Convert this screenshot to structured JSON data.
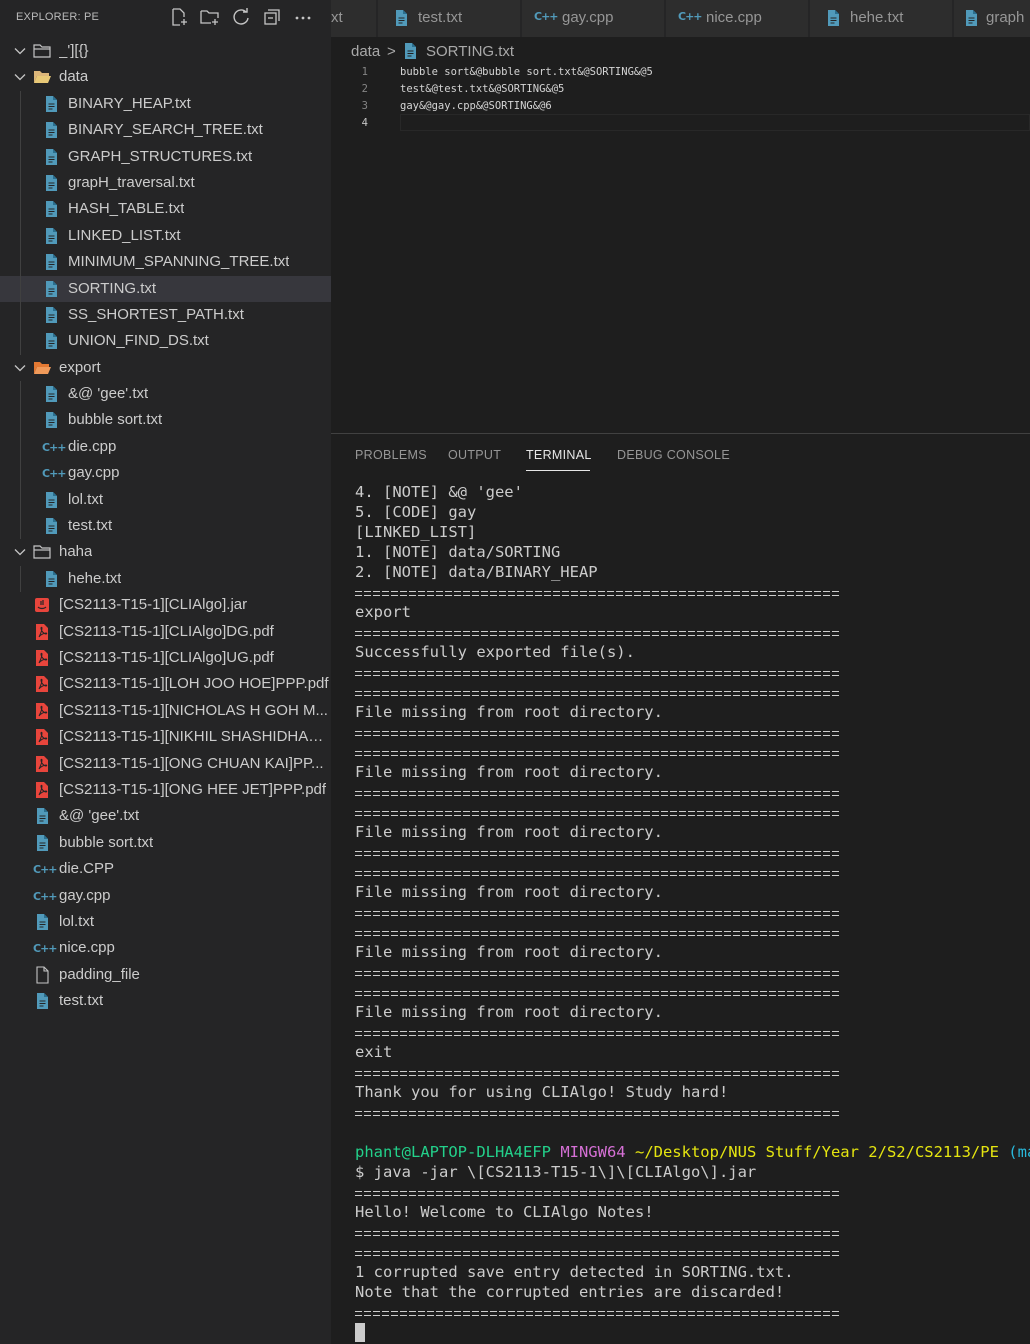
{
  "sidebar": {
    "title": "EXPLORER: PE",
    "tree": [
      {
        "label": "_'][{}",
        "kind": "folder",
        "depth": 0,
        "expanded": true
      },
      {
        "label": "data",
        "kind": "folder-open",
        "depth": 0,
        "expanded": true
      },
      {
        "label": "BINARY_HEAP.txt",
        "kind": "txt",
        "depth": 1
      },
      {
        "label": "BINARY_SEARCH_TREE.txt",
        "kind": "txt",
        "depth": 1
      },
      {
        "label": "GRAPH_STRUCTURES.txt",
        "kind": "txt",
        "depth": 1
      },
      {
        "label": "grapH_traversal.txt",
        "kind": "txt",
        "depth": 1
      },
      {
        "label": "HASH_TABLE.txt",
        "kind": "txt",
        "depth": 1
      },
      {
        "label": "LINKED_LIST.txt",
        "kind": "txt",
        "depth": 1
      },
      {
        "label": "MINIMUM_SPANNING_TREE.txt",
        "kind": "txt",
        "depth": 1
      },
      {
        "label": "SORTING.txt",
        "kind": "txt",
        "depth": 1,
        "selected": true
      },
      {
        "label": "SS_SHORTEST_PATH.txt",
        "kind": "txt",
        "depth": 1
      },
      {
        "label": "UNION_FIND_DS.txt",
        "kind": "txt",
        "depth": 1
      },
      {
        "label": "export",
        "kind": "folder-export",
        "depth": 0,
        "expanded": true
      },
      {
        "label": "&@ 'gee'.txt",
        "kind": "txt",
        "depth": 1
      },
      {
        "label": "bubble sort.txt",
        "kind": "txt",
        "depth": 1
      },
      {
        "label": "die.cpp",
        "kind": "cpp",
        "depth": 1
      },
      {
        "label": "gay.cpp",
        "kind": "cpp",
        "depth": 1
      },
      {
        "label": "lol.txt",
        "kind": "txt",
        "depth": 1
      },
      {
        "label": "test.txt",
        "kind": "txt",
        "depth": 1
      },
      {
        "label": "haha",
        "kind": "folder",
        "depth": 0,
        "expanded": true
      },
      {
        "label": "hehe.txt",
        "kind": "txt",
        "depth": 1
      },
      {
        "label": "[CS2113-T15-1][CLIAlgo].jar",
        "kind": "jar",
        "depth": 0,
        "leaf": true
      },
      {
        "label": "[CS2113-T15-1][CLIAlgo]DG.pdf",
        "kind": "pdf",
        "depth": 0,
        "leaf": true
      },
      {
        "label": "[CS2113-T15-1][CLIAlgo]UG.pdf",
        "kind": "pdf",
        "depth": 0,
        "leaf": true
      },
      {
        "label": "[CS2113-T15-1][LOH JOO HOE]PPP.pdf",
        "kind": "pdf",
        "depth": 0,
        "leaf": true
      },
      {
        "label": "[CS2113-T15-1][NICHOLAS H GOH M...",
        "kind": "pdf",
        "depth": 0,
        "leaf": true
      },
      {
        "label": "[CS2113-T15-1][NIKHIL SHASHIDHAR...",
        "kind": "pdf",
        "depth": 0,
        "leaf": true
      },
      {
        "label": "[CS2113-T15-1][ONG CHUAN KAI]PP...",
        "kind": "pdf",
        "depth": 0,
        "leaf": true
      },
      {
        "label": "[CS2113-T15-1][ONG HEE JET]PPP.pdf",
        "kind": "pdf",
        "depth": 0,
        "leaf": true
      },
      {
        "label": "&@ 'gee'.txt",
        "kind": "txt",
        "depth": 0,
        "leaf": true
      },
      {
        "label": "bubble sort.txt",
        "kind": "txt",
        "depth": 0,
        "leaf": true
      },
      {
        "label": "die.CPP",
        "kind": "cpp",
        "depth": 0,
        "leaf": true
      },
      {
        "label": "gay.cpp",
        "kind": "cpp",
        "depth": 0,
        "leaf": true
      },
      {
        "label": "lol.txt",
        "kind": "txt",
        "depth": 0,
        "leaf": true
      },
      {
        "label": "nice.cpp",
        "kind": "cpp",
        "depth": 0,
        "leaf": true
      },
      {
        "label": "padding_file",
        "kind": "blank",
        "depth": 0,
        "leaf": true
      },
      {
        "label": "test.txt",
        "kind": "txt",
        "depth": 0,
        "leaf": true
      }
    ]
  },
  "tabs": [
    {
      "label": "xt",
      "kind": "none"
    },
    {
      "label": "test.txt",
      "kind": "txt"
    },
    {
      "label": "gay.cpp",
      "kind": "cpp"
    },
    {
      "label": "nice.cpp",
      "kind": "cpp"
    },
    {
      "label": "hehe.txt",
      "kind": "txt"
    },
    {
      "label": "graph",
      "kind": "txt"
    }
  ],
  "breadcrumb": {
    "folder": "data",
    "separator": ">",
    "file": "SORTING.txt"
  },
  "editor": {
    "lines": [
      {
        "num": "1",
        "text": "bubble sort&@bubble sort.txt&@SORTING&@5"
      },
      {
        "num": "2",
        "text": "test&@test.txt&@SORTING&@5"
      },
      {
        "num": "3",
        "text": "gay&@gay.cpp&@SORTING&@6"
      },
      {
        "num": "4",
        "text": ""
      }
    ]
  },
  "panel": {
    "tabs": [
      "PROBLEMS",
      "OUTPUT",
      "TERMINAL",
      "DEBUG CONSOLE"
    ],
    "active_tab": "TERMINAL"
  },
  "terminal": {
    "lines": [
      {
        "t": "text",
        "v": "4. [NOTE] &@ 'gee'"
      },
      {
        "t": "text",
        "v": "5. [CODE] gay"
      },
      {
        "t": "text",
        "v": "[LINKED_LIST]"
      },
      {
        "t": "text",
        "v": "1. [NOTE] data/SORTING"
      },
      {
        "t": "text",
        "v": "2. [NOTE] data/BINARY_HEAP"
      },
      {
        "t": "sep"
      },
      {
        "t": "text",
        "v": "export"
      },
      {
        "t": "sep"
      },
      {
        "t": "text",
        "v": "Successfully exported file(s)."
      },
      {
        "t": "sep"
      },
      {
        "t": "sep"
      },
      {
        "t": "text",
        "v": "File missing from root directory."
      },
      {
        "t": "sep"
      },
      {
        "t": "sep"
      },
      {
        "t": "text",
        "v": "File missing from root directory."
      },
      {
        "t": "sep"
      },
      {
        "t": "sep"
      },
      {
        "t": "text",
        "v": "File missing from root directory."
      },
      {
        "t": "sep"
      },
      {
        "t": "sep"
      },
      {
        "t": "text",
        "v": "File missing from root directory."
      },
      {
        "t": "sep"
      },
      {
        "t": "sep"
      },
      {
        "t": "text",
        "v": "File missing from root directory."
      },
      {
        "t": "sep"
      },
      {
        "t": "sep"
      },
      {
        "t": "text",
        "v": "File missing from root directory."
      },
      {
        "t": "sep"
      },
      {
        "t": "text",
        "v": "exit"
      },
      {
        "t": "sep"
      },
      {
        "t": "text",
        "v": "Thank you for using CLIAlgo! Study hard!"
      },
      {
        "t": "sep"
      },
      {
        "t": "blank"
      },
      {
        "t": "prompt",
        "user": "phant@LAPTOP-DLHA4EFP",
        "host": "MINGW64",
        "path": "~/Desktop/NUS Stuff/Year 2/S2/CS2113/PE",
        "branch": "(mast"
      },
      {
        "t": "text",
        "v": "$ java -jar \\[CS2113-T15-1\\]\\[CLIAlgo\\].jar"
      },
      {
        "t": "sep"
      },
      {
        "t": "text",
        "v": "Hello! Welcome to CLIAlgo Notes!"
      },
      {
        "t": "sep"
      },
      {
        "t": "sep"
      },
      {
        "t": "text",
        "v": "1 corrupted save entry detected in SORTING.txt."
      },
      {
        "t": "text",
        "v": "Note that the corrupted entries are discarded!"
      },
      {
        "t": "sep"
      },
      {
        "t": "cursor"
      }
    ]
  },
  "colors": {
    "txt_icon": "#519aba",
    "cpp_icon": "#519aba",
    "pdf_icon": "#e8453c",
    "jar_icon": "#e8453c",
    "folder_icon": "#c5c5c5",
    "folder_data": "#dcb67a",
    "folder_export": "#e37933",
    "prompt_user": "#23d18b",
    "prompt_host": "#d670d6",
    "prompt_path": "#e5e510",
    "prompt_branch": "#29b8db"
  }
}
